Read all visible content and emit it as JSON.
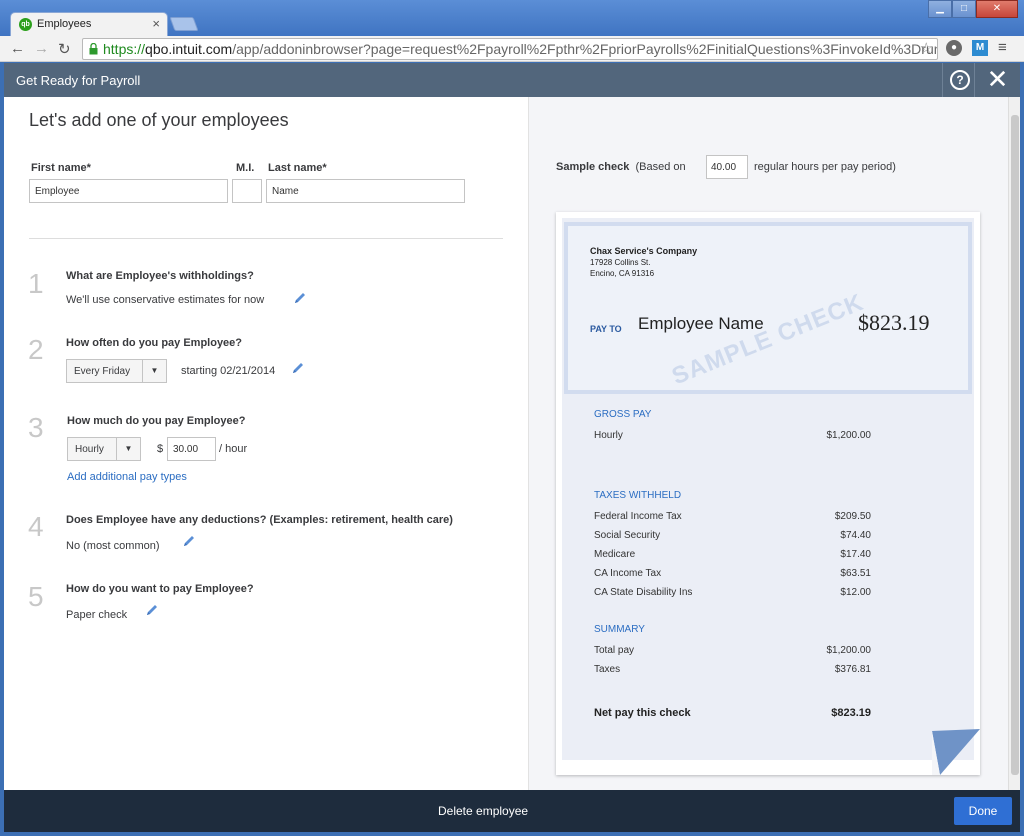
{
  "browser": {
    "tab_title": "Employees",
    "favicon": "qb",
    "url_scheme": "https://",
    "url_host": "qbo.intuit.com",
    "url_path": "/app/addoninbrowser?page=request%2Fpayroll%2Fpthr%2FpriorPayrolls%2FinitialQuestions%3FinvokeId%3DrunP",
    "ext_m": "M"
  },
  "header": {
    "title": "Get Ready for Payroll",
    "help_icon": "?",
    "close_icon": "✕"
  },
  "form": {
    "heading": "Let's add one of your employees",
    "first_name_label": "First name*",
    "first_name_value": "Employee",
    "mi_label": "M.I.",
    "mi_value": "",
    "last_name_label": "Last name*",
    "last_name_value": "Name",
    "steps": [
      {
        "num": "1",
        "question": "What are Employee's withholdings?",
        "answer": "We'll use conservative estimates for now"
      },
      {
        "num": "2",
        "question": "How often do you pay Employee?",
        "frequency": "Every Friday",
        "starting": "starting 02/21/2014"
      },
      {
        "num": "3",
        "question": "How much do you pay Employee?",
        "pay_type": "Hourly",
        "currency": "$",
        "rate": "30.00",
        "unit": "/ hour",
        "add_link": "Add additional pay types"
      },
      {
        "num": "4",
        "question": "Does Employee have any deductions? (Examples: retirement, health care)",
        "answer": "No (most common)"
      },
      {
        "num": "5",
        "question": "How do you want to pay Employee?",
        "answer": "Paper check"
      }
    ]
  },
  "sample": {
    "label_bold": "Sample check",
    "label_pre": "(Based on",
    "hours": "40.00",
    "label_post": "regular hours per pay period)",
    "company": "Chax Service's Company",
    "address1": "17928 Collins St.",
    "address2": "Encino, CA 91316",
    "pay_to": "PAY TO",
    "payee": "Employee Name",
    "amount": "$823.19",
    "watermark": "SAMPLE CHECK",
    "gross_heading": "GROSS PAY",
    "gross_rows": [
      {
        "label": "Hourly",
        "value": "$1,200.00"
      }
    ],
    "taxes_heading": "TAXES WITHHELD",
    "tax_rows": [
      {
        "label": "Federal Income Tax",
        "value": "$209.50"
      },
      {
        "label": "Social Security",
        "value": "$74.40"
      },
      {
        "label": "Medicare",
        "value": "$17.40"
      },
      {
        "label": "CA Income Tax",
        "value": "$63.51"
      },
      {
        "label": "CA State Disability Ins",
        "value": "$12.00"
      }
    ],
    "summary_heading": "SUMMARY",
    "summary_rows": [
      {
        "label": "Total pay",
        "value": "$1,200.00"
      },
      {
        "label": "Taxes",
        "value": "$376.81"
      }
    ],
    "net_label": "Net pay this check",
    "net_value": "$823.19"
  },
  "footer": {
    "delete_label": "Delete employee",
    "done_label": "Done"
  },
  "colors": {
    "header_bg": "#52667c",
    "footer_bg": "#1e2c3d",
    "link": "#2b6dc2",
    "done_button": "#2f6fd4"
  },
  "icons": {
    "back": "back-arrow-icon",
    "forward": "forward-arrow-icon",
    "reload": "reload-icon",
    "lock": "lock-icon",
    "star": "star-icon",
    "pencil": "pencil-icon",
    "menu": "hamburger-menu-icon",
    "help": "help-circle-icon",
    "close": "close-icon"
  }
}
